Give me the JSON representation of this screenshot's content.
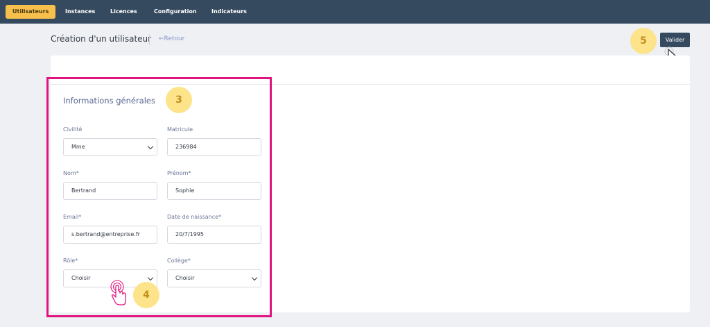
{
  "nav": {
    "tabs": [
      {
        "label": "Utilisateurs",
        "active": true
      },
      {
        "label": "Instances",
        "active": false
      },
      {
        "label": "Licences",
        "active": false
      },
      {
        "label": "Configuration",
        "active": false
      },
      {
        "label": "Indicateurs",
        "active": false
      }
    ]
  },
  "header": {
    "title": "Création d'un utilisateur",
    "back_label": "←Retour",
    "validate_label": "Valider"
  },
  "form": {
    "section_title": "Informations générales",
    "civilite": {
      "label": "Civilité",
      "value": "Mme"
    },
    "matricule": {
      "label": "Matricule",
      "value": "236984"
    },
    "nom": {
      "label": "Nom*",
      "value": "Bertrand"
    },
    "prenom": {
      "label": "Prénom*",
      "value": "Sophie"
    },
    "email": {
      "label": "Email*",
      "value": "s.bertrand@entreprise.fr"
    },
    "naissance": {
      "label": "Date de naissance*",
      "value": "20/7/1995"
    },
    "role": {
      "label": "Rôle*",
      "value": "Choisir"
    },
    "college": {
      "label": "Collège*",
      "value": "Choisir"
    }
  },
  "annotations": {
    "step3": "3",
    "step4": "4",
    "step5": "5"
  },
  "colors": {
    "nav_bg": "#364a5f",
    "active_tab": "#f7c04c",
    "highlight": "#e0137f",
    "badge": "#fde38a"
  },
  "icons": [
    "pointer-cursor-icon",
    "tap-hand-icon",
    "chevron-down-icon"
  ]
}
